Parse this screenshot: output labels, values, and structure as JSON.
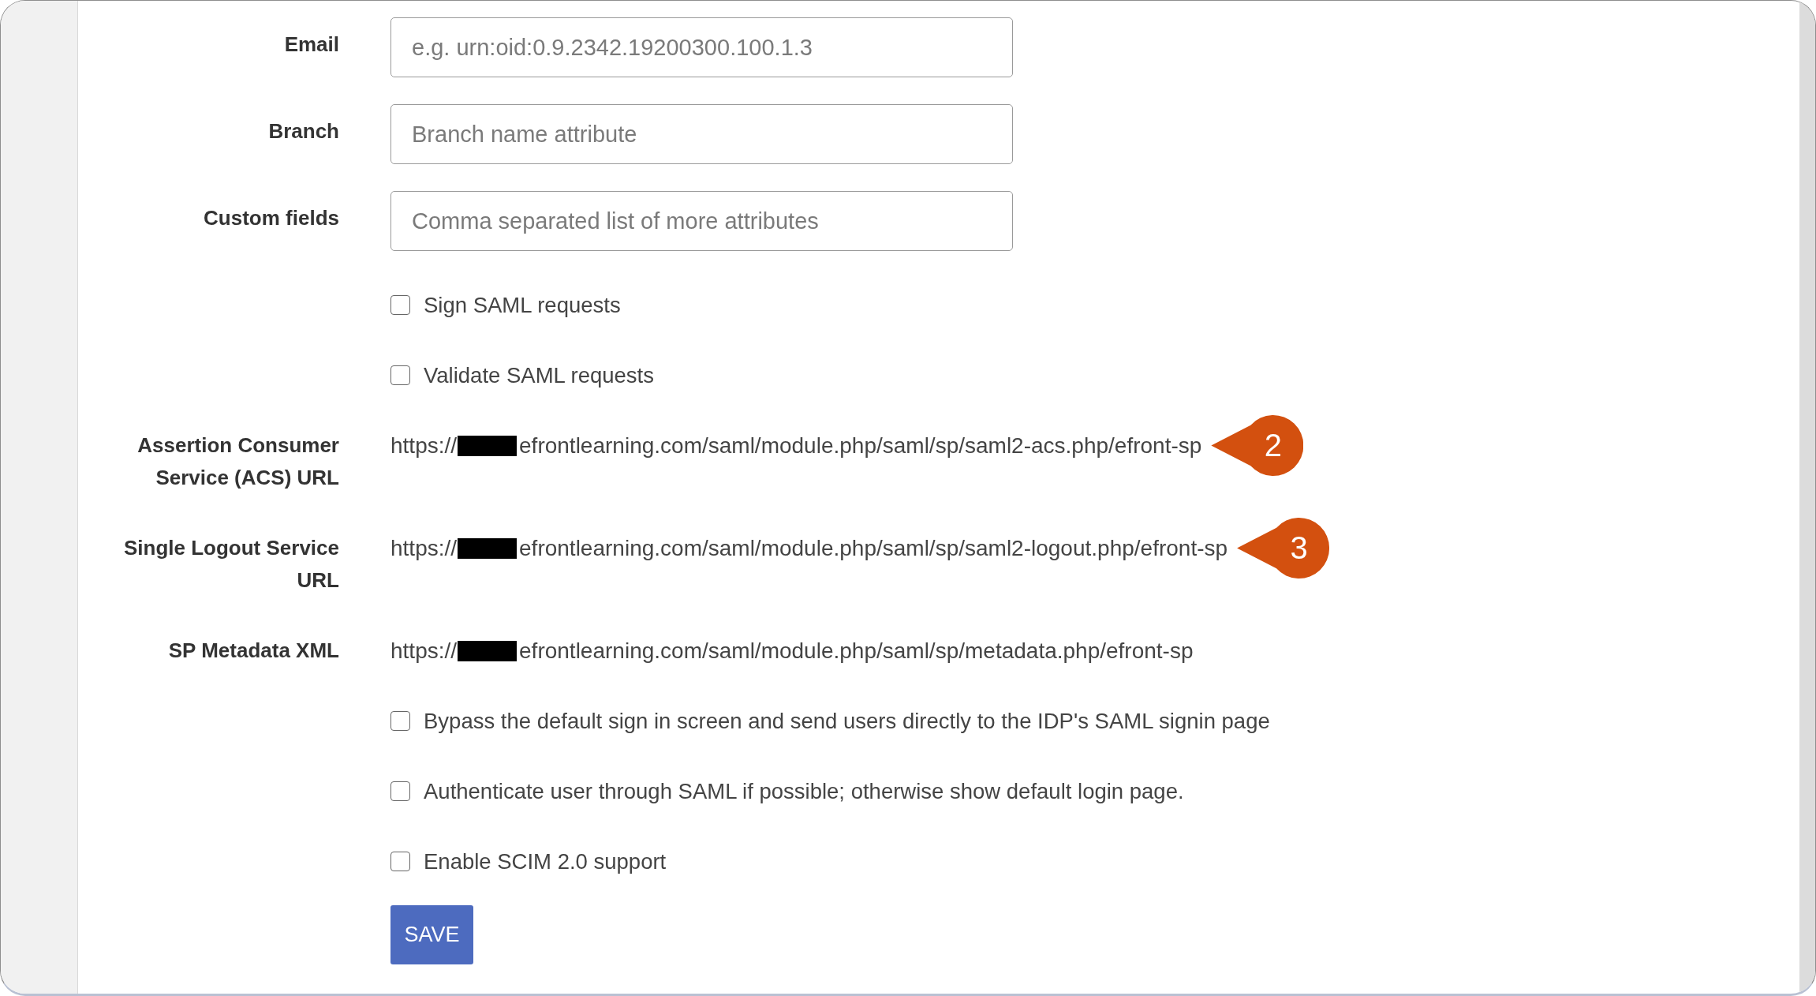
{
  "form": {
    "rows": [
      {
        "kind": "input",
        "label": "Email",
        "placeholder": "e.g. urn:oid:0.9.2342.19200300.100.1.3"
      },
      {
        "kind": "input",
        "label": "Branch",
        "placeholder": "Branch name attribute"
      },
      {
        "kind": "input",
        "label": "Custom fields",
        "placeholder": "Comma separated list of more attributes"
      },
      {
        "kind": "checkbox",
        "label": "Sign SAML requests",
        "checked": false
      },
      {
        "kind": "checkbox",
        "label": "Validate SAML requests",
        "checked": false
      },
      {
        "kind": "url",
        "label": "Assertion Consumer Service (ACS) URL",
        "url_start": "https://",
        "redacted": true,
        "url_end": "efrontlearning.com/saml/module.php/saml/sp/saml2-acs.php/efront-sp",
        "callout": "2"
      },
      {
        "kind": "url",
        "label": "Single Logout Service URL",
        "url_start": "https://",
        "redacted": true,
        "url_end": "efrontlearning.com/saml/module.php/saml/sp/saml2-logout.php/efront-sp",
        "callout": "3"
      },
      {
        "kind": "url",
        "label": "SP Metadata XML",
        "url_start": "https://",
        "redacted": true,
        "url_end": "efrontlearning.com/saml/module.php/saml/sp/metadata.php/efront-sp"
      },
      {
        "kind": "checkbox",
        "label": "Bypass the default sign in screen and send users directly to the IDP's SAML signin page",
        "checked": false
      },
      {
        "kind": "checkbox",
        "label": "Authenticate user through SAML if possible; otherwise show default login page.",
        "checked": false
      },
      {
        "kind": "checkbox",
        "label": "Enable SCIM 2.0 support",
        "checked": false
      }
    ],
    "save_button": {
      "label": "SAVE"
    }
  }
}
